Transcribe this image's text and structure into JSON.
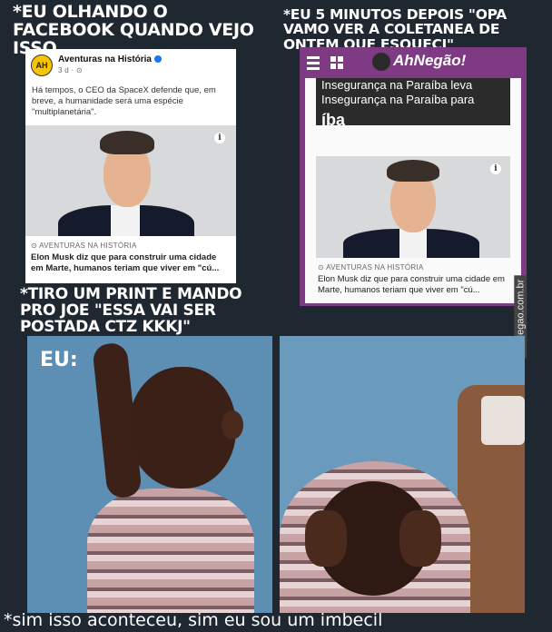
{
  "captions": {
    "top_left": "*EU OLHANDO O FACEBOOK QUANDO VEJO ISSO",
    "top_right": "*EU 5 MINUTOS DEPOIS \"OPA VAMO VER A COLETANEA DE ONTEM QUE ESQUECI\"",
    "middle_left": "*TIRO UM PRINT E MANDO PRO JOE \"ESSA VAI SER POSTADA CTZ KKKJ\"",
    "eu": "EU:",
    "bottom": "*sim isso aconteceu, sim eu sou um imbecil"
  },
  "facebook_post": {
    "avatar_text": "AH",
    "page_name": "Aventuras na História",
    "meta": "3 d · ⊙",
    "body": "Há tempos, o CEO da SpaceX defende que, em breve, a humanidade será uma espécie \"multiplanetária\".",
    "source": "AVENTURAS NA HISTÓRIA",
    "headline": "Elon Musk diz que para construir uma cidade em Marte, humanos teriam que viver em \"cú..."
  },
  "ahnegao": {
    "logo": "AhNegão!",
    "prev_headline": "Insegurança na Paraíba leva Insegurança na Paraíba para",
    "prev_tag": "íba",
    "source": "AVENTURAS NA HISTÓRIA",
    "headline": "Elon Musk diz que para construir uma cidade em Marte, humanos teriam que viver em \"cú...",
    "watermark": "AhNegao.com.br"
  }
}
